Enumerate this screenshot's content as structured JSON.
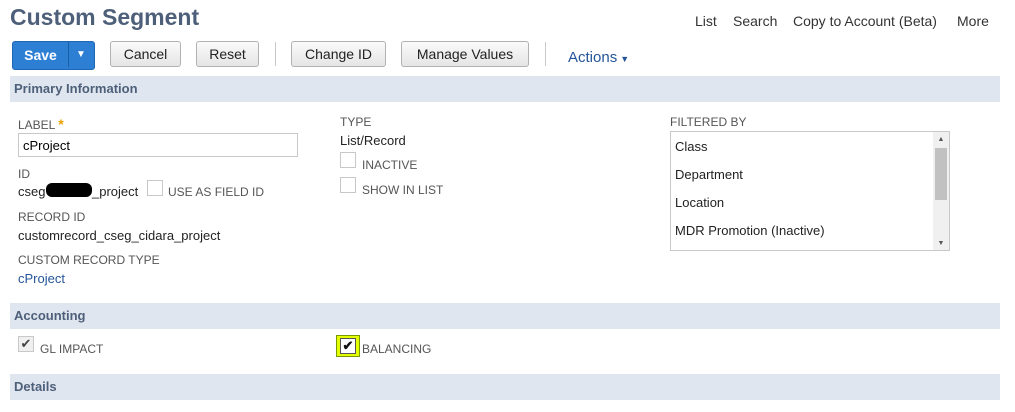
{
  "page": {
    "title": "Custom Segment"
  },
  "topnav": {
    "list": "List",
    "search": "Search",
    "copy": "Copy to Account (Beta)",
    "more": "More"
  },
  "toolbar": {
    "save": "Save",
    "save_arrow": "▼",
    "cancel": "Cancel",
    "reset": "Reset",
    "change_id": "Change ID",
    "manage_values": "Manage Values",
    "actions": "Actions",
    "actions_caret": "▼"
  },
  "primary": {
    "heading": "Primary Information",
    "label_label": "LABEL",
    "label_required": "*",
    "label_value": "cProject",
    "id_label": "ID",
    "id_prefix": "cseg",
    "id_suffix": "_project",
    "use_as_field_id": "USE AS FIELD ID",
    "record_id_label": "RECORD ID",
    "record_id_value": "customrecord_cseg_cidara_project",
    "custom_record_type_label": "CUSTOM RECORD TYPE",
    "custom_record_type_value": "cProject",
    "type_label": "TYPE",
    "type_value": "List/Record",
    "inactive": "INACTIVE",
    "show_in_list": "SHOW IN LIST",
    "filtered_by_label": "FILTERED BY",
    "filtered_by_options": [
      "Class",
      "Department",
      "Location",
      "MDR Promotion (Inactive)"
    ]
  },
  "accounting": {
    "heading": "Accounting",
    "gl_impact": "GL IMPACT",
    "gl_impact_checked": true,
    "balancing": "BALANCING",
    "balancing_checked": true,
    "check_glyph": "✔"
  },
  "details": {
    "heading": "Details"
  },
  "colors": {
    "accent": "#2d7fd4",
    "section_bg": "#e0e6ef",
    "title": "#4d5f79",
    "link": "#255599",
    "highlight": "#e4ff00"
  }
}
